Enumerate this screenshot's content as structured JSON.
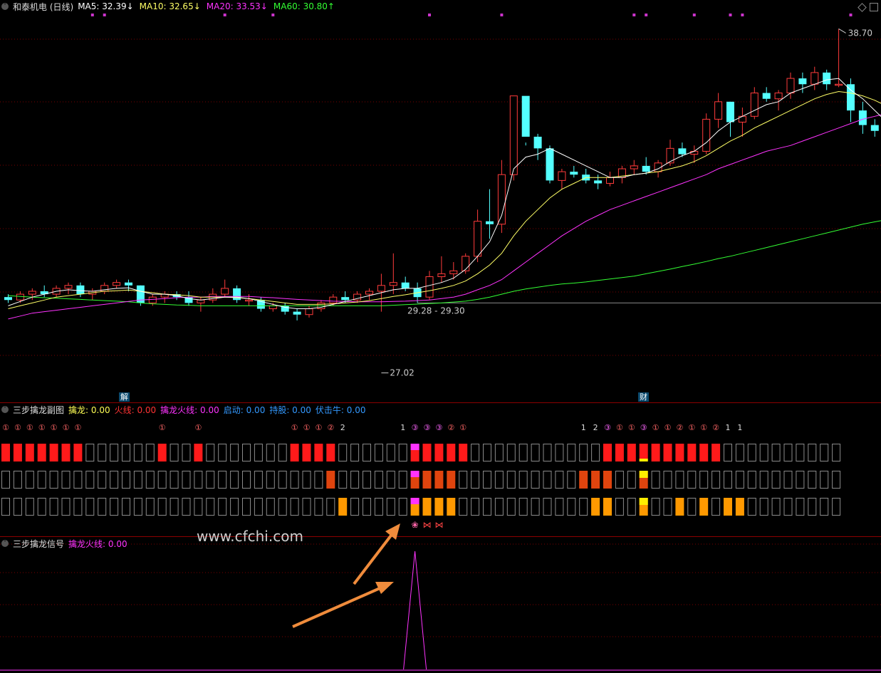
{
  "main": {
    "title": "和泰机电 (日线)",
    "ma": [
      {
        "label": "MA5: 32.39",
        "arrow": "↓",
        "color": "#ffffff"
      },
      {
        "label": "MA10: 32.65",
        "arrow": "↓",
        "color": "#ffff66"
      },
      {
        "label": "MA20: 33.53",
        "arrow": "↓",
        "color": "#ff33ff"
      },
      {
        "label": "MA60: 30.80",
        "arrow": "↑",
        "color": "#33ff33"
      }
    ],
    "high_label": "38.70",
    "low_label": "27.02",
    "range_label": "29.28 - 29.30",
    "tag_jie": "解",
    "tag_cai": "财",
    "colors": {
      "up": "#ff3b3b",
      "down": "#54ffff",
      "ma5": "#ffffff",
      "ma10": "#ffff66",
      "ma20": "#ff33ff",
      "ma60": "#33ff33",
      "grid": "#7a0000"
    },
    "price_range": [
      26.5,
      39.2
    ],
    "ohlc": [
      [
        29.5,
        29.6,
        29.3,
        29.4
      ],
      [
        29.4,
        29.7,
        29.3,
        29.6
      ],
      [
        29.6,
        29.8,
        29.4,
        29.7
      ],
      [
        29.7,
        29.9,
        29.5,
        29.6
      ],
      [
        29.6,
        29.9,
        29.5,
        29.8
      ],
      [
        29.8,
        30.0,
        29.6,
        29.9
      ],
      [
        29.9,
        30.0,
        29.5,
        29.6
      ],
      [
        29.6,
        29.8,
        29.4,
        29.7
      ],
      [
        29.7,
        30.0,
        29.6,
        29.9
      ],
      [
        29.9,
        30.1,
        29.8,
        30.0
      ],
      [
        30.0,
        30.1,
        29.7,
        29.9
      ],
      [
        29.9,
        29.9,
        29.2,
        29.3
      ],
      [
        29.3,
        29.6,
        29.2,
        29.5
      ],
      [
        29.5,
        29.7,
        29.3,
        29.6
      ],
      [
        29.6,
        29.7,
        29.4,
        29.5
      ],
      [
        29.5,
        29.7,
        29.2,
        29.3
      ],
      [
        29.3,
        29.5,
        29.0,
        29.4
      ],
      [
        29.4,
        29.8,
        29.3,
        29.6
      ],
      [
        29.6,
        30.1,
        29.5,
        29.8
      ],
      [
        29.8,
        29.9,
        29.3,
        29.4
      ],
      [
        29.4,
        29.6,
        29.2,
        29.4
      ],
      [
        29.4,
        29.5,
        29.0,
        29.1
      ],
      [
        29.1,
        29.3,
        29.0,
        29.2
      ],
      [
        29.2,
        29.3,
        28.9,
        29.0
      ],
      [
        29.0,
        29.1,
        28.7,
        28.9
      ],
      [
        28.9,
        29.2,
        28.8,
        29.1
      ],
      [
        29.1,
        29.4,
        29.0,
        29.3
      ],
      [
        29.3,
        29.6,
        29.2,
        29.5
      ],
      [
        29.5,
        29.7,
        29.3,
        29.4
      ],
      [
        29.4,
        29.7,
        29.3,
        29.6
      ],
      [
        29.6,
        29.8,
        29.4,
        29.7
      ],
      [
        29.7,
        30.3,
        29.0,
        29.9
      ],
      [
        29.9,
        31.0,
        29.6,
        30.0
      ],
      [
        30.0,
        30.2,
        29.7,
        29.8
      ],
      [
        29.8,
        30.0,
        29.3,
        29.5
      ],
      [
        29.5,
        30.4,
        29.4,
        30.2
      ],
      [
        30.2,
        30.9,
        30.0,
        30.3
      ],
      [
        30.3,
        30.7,
        30.1,
        30.4
      ],
      [
        30.4,
        31.0,
        30.3,
        30.9
      ],
      [
        30.9,
        32.5,
        30.7,
        32.1
      ],
      [
        32.1,
        33.2,
        31.5,
        32.0
      ],
      [
        32.0,
        34.2,
        31.7,
        33.7
      ],
      [
        33.7,
        36.4,
        33.5,
        36.4
      ],
      [
        36.4,
        34.8,
        34.7,
        35.0
      ],
      [
        35.0,
        35.1,
        34.2,
        34.6
      ],
      [
        34.6,
        34.7,
        33.4,
        33.5
      ],
      [
        33.5,
        33.9,
        33.2,
        33.8
      ],
      [
        33.8,
        34.0,
        33.6,
        33.7
      ],
      [
        33.7,
        33.9,
        33.4,
        33.5
      ],
      [
        33.5,
        33.7,
        33.2,
        33.4
      ],
      [
        33.4,
        33.8,
        33.3,
        33.6
      ],
      [
        33.6,
        34.0,
        33.4,
        33.9
      ],
      [
        33.9,
        34.2,
        33.7,
        34.0
      ],
      [
        34.0,
        34.3,
        33.7,
        33.8
      ],
      [
        33.8,
        34.2,
        33.6,
        34.1
      ],
      [
        34.1,
        34.9,
        34.0,
        34.6
      ],
      [
        34.6,
        34.8,
        34.3,
        34.4
      ],
      [
        34.4,
        34.7,
        34.1,
        34.5
      ],
      [
        34.5,
        35.8,
        34.4,
        35.6
      ],
      [
        35.6,
        36.5,
        35.3,
        36.2
      ],
      [
        36.2,
        36.2,
        35.0,
        35.5
      ],
      [
        35.5,
        36.0,
        35.0,
        35.7
      ],
      [
        35.7,
        36.7,
        35.6,
        36.5
      ],
      [
        36.5,
        36.7,
        36.2,
        36.3
      ],
      [
        36.3,
        36.6,
        35.9,
        36.5
      ],
      [
        36.5,
        37.2,
        36.3,
        37.0
      ],
      [
        37.0,
        37.2,
        36.5,
        36.8
      ],
      [
        36.8,
        37.4,
        36.6,
        37.2
      ],
      [
        37.2,
        37.3,
        36.6,
        36.8
      ],
      [
        36.8,
        38.7,
        36.7,
        36.8
      ],
      [
        36.8,
        37.0,
        35.5,
        35.9
      ],
      [
        35.9,
        36.2,
        35.1,
        35.4
      ],
      [
        35.4,
        35.6,
        35.0,
        35.2
      ],
      [
        35.2,
        35.5,
        34.9,
        35.3
      ],
      [
        35.3,
        35.5,
        34.6,
        34.8
      ],
      [
        34.8,
        35.2,
        34.4,
        34.5
      ],
      [
        34.5,
        34.7,
        34.2,
        34.3
      ],
      [
        34.3,
        34.8,
        34.2,
        34.6
      ],
      [
        34.6,
        35.0,
        34.5,
        34.9
      ],
      [
        34.9,
        35.2,
        34.5,
        35.0
      ],
      [
        35.0,
        35.3,
        34.3,
        34.4
      ]
    ],
    "ma5": [
      29.2,
      29.35,
      29.5,
      29.6,
      29.7,
      29.75,
      29.72,
      29.7,
      29.75,
      29.8,
      29.82,
      29.7,
      29.6,
      29.6,
      29.55,
      29.45,
      29.4,
      29.45,
      29.5,
      29.5,
      29.45,
      29.35,
      29.25,
      29.15,
      29.1,
      29.1,
      29.15,
      29.25,
      29.35,
      29.45,
      29.55,
      29.65,
      29.75,
      29.8,
      29.8,
      29.9,
      30.0,
      30.15,
      30.45,
      30.9,
      31.4,
      32.3,
      33.9,
      34.3,
      34.4,
      34.6,
      34.4,
      34.2,
      34.0,
      33.8,
      33.6,
      33.6,
      33.7,
      33.75,
      33.9,
      34.15,
      34.35,
      34.5,
      34.8,
      35.2,
      35.5,
      35.7,
      35.9,
      36.1,
      36.2,
      36.5,
      36.65,
      36.8,
      36.95,
      37.0,
      36.6,
      36.3,
      35.9,
      35.5,
      35.2,
      34.9,
      34.7,
      34.6,
      34.6,
      34.65,
      34.6
    ],
    "ma10": [
      29.1,
      29.2,
      29.3,
      29.4,
      29.5,
      29.55,
      29.6,
      29.65,
      29.7,
      29.72,
      29.74,
      29.7,
      29.65,
      29.6,
      29.58,
      29.55,
      29.5,
      29.5,
      29.5,
      29.48,
      29.45,
      29.4,
      29.35,
      29.3,
      29.25,
      29.25,
      29.25,
      29.27,
      29.3,
      29.33,
      29.38,
      29.45,
      29.52,
      29.58,
      29.65,
      29.72,
      29.8,
      29.9,
      30.05,
      30.3,
      30.6,
      31.0,
      31.6,
      32.1,
      32.5,
      32.9,
      33.2,
      33.4,
      33.6,
      33.6,
      33.6,
      33.65,
      33.7,
      33.75,
      33.8,
      33.9,
      34.0,
      34.15,
      34.35,
      34.6,
      34.85,
      35.05,
      35.3,
      35.5,
      35.7,
      35.9,
      36.1,
      36.3,
      36.45,
      36.55,
      36.5,
      36.4,
      36.25,
      36.05,
      35.85,
      35.65,
      35.45,
      35.25,
      35.1,
      34.95,
      34.8
    ],
    "ma20": [
      28.75,
      28.85,
      28.95,
      29.0,
      29.05,
      29.1,
      29.15,
      29.2,
      29.25,
      29.3,
      29.35,
      29.4,
      29.42,
      29.45,
      29.48,
      29.5,
      29.5,
      29.52,
      29.52,
      29.52,
      29.52,
      29.5,
      29.48,
      29.45,
      29.42,
      29.4,
      29.38,
      29.36,
      29.35,
      29.34,
      29.34,
      29.34,
      29.35,
      29.36,
      29.38,
      29.4,
      29.45,
      29.5,
      29.6,
      29.75,
      29.9,
      30.1,
      30.4,
      30.7,
      31.0,
      31.3,
      31.6,
      31.85,
      32.1,
      32.3,
      32.5,
      32.65,
      32.8,
      32.95,
      33.1,
      33.25,
      33.4,
      33.55,
      33.7,
      33.9,
      34.05,
      34.2,
      34.35,
      34.5,
      34.6,
      34.7,
      34.85,
      35.0,
      35.15,
      35.3,
      35.45,
      35.6,
      35.7,
      35.8,
      35.9,
      35.95,
      36.0,
      36.05,
      36.1,
      36.05,
      36.0
    ],
    "ma60": [
      29.55,
      29.52,
      29.5,
      29.48,
      29.46,
      29.44,
      29.42,
      29.4,
      29.38,
      29.36,
      29.34,
      29.3,
      29.27,
      29.25,
      29.23,
      29.22,
      29.2,
      29.2,
      29.2,
      29.2,
      29.2,
      29.2,
      29.2,
      29.2,
      29.2,
      29.2,
      29.2,
      29.2,
      29.2,
      29.2,
      29.2,
      29.2,
      29.22,
      29.24,
      29.26,
      29.28,
      29.3,
      29.33,
      29.36,
      29.42,
      29.5,
      29.6,
      29.7,
      29.78,
      29.84,
      29.9,
      29.95,
      29.98,
      30.02,
      30.07,
      30.12,
      30.17,
      30.22,
      30.3,
      30.38,
      30.46,
      30.55,
      30.63,
      30.72,
      30.82,
      30.9,
      31.0,
      31.1,
      31.2,
      31.3,
      31.4,
      31.5,
      31.6,
      31.7,
      31.8,
      31.9,
      32.0,
      32.08,
      32.16,
      32.24,
      32.32,
      32.4,
      32.48,
      32.56,
      32.64,
      32.72
    ],
    "top_markers": [
      7,
      8,
      18,
      22,
      35,
      41,
      52,
      53,
      57,
      60,
      61,
      70
    ]
  },
  "sub1": {
    "title": "三步擒龙副图",
    "items": [
      {
        "label": "擒龙: 0.00",
        "color": "#ffff55"
      },
      {
        "label": "火线: 0.00",
        "color": "#ff3333"
      },
      {
        "label": "擒龙火线: 0.00",
        "color": "#ff33ff"
      },
      {
        "label": "启动: 0.00",
        "color": "#3399ff"
      },
      {
        "label": "持股: 0.00",
        "color": "#3399ff"
      },
      {
        "label": "伏击牛: 0.00",
        "color": "#3399ff"
      }
    ],
    "row1_on": [
      0,
      1,
      2,
      3,
      4,
      5,
      6,
      13,
      16,
      24,
      25,
      26,
      27,
      34,
      35,
      36,
      37,
      38,
      50,
      51,
      52,
      53,
      54,
      55,
      56,
      57,
      58,
      59
    ],
    "row1_pink": [
      34
    ],
    "row1_yellow": [
      53
    ],
    "row2_on": [
      27,
      34,
      35,
      36,
      37,
      48,
      49,
      50,
      53
    ],
    "row2_pink": [
      34
    ],
    "row2_yellow": [
      53
    ],
    "row3_on": [
      28,
      34,
      35,
      36,
      37,
      49,
      50,
      53,
      56,
      58,
      60,
      61
    ],
    "row3_pink": [
      34
    ],
    "row3_yellow": [
      53
    ],
    "marks": [
      {
        "i": 0,
        "t": "①"
      },
      {
        "i": 1,
        "t": "①"
      },
      {
        "i": 2,
        "t": "①"
      },
      {
        "i": 3,
        "t": "①"
      },
      {
        "i": 4,
        "t": "①"
      },
      {
        "i": 5,
        "t": "①"
      },
      {
        "i": 6,
        "t": "①"
      },
      {
        "i": 13,
        "t": "①"
      },
      {
        "i": 16,
        "t": "①"
      },
      {
        "i": 24,
        "t": "①"
      },
      {
        "i": 25,
        "t": "①"
      },
      {
        "i": 26,
        "t": "①"
      },
      {
        "i": 27,
        "t": "②"
      },
      {
        "i": 28,
        "t": "2"
      },
      {
        "i": 33,
        "t": "1"
      },
      {
        "i": 34,
        "t": "③"
      },
      {
        "i": 35,
        "t": "③"
      },
      {
        "i": 36,
        "t": "③"
      },
      {
        "i": 37,
        "t": "②"
      },
      {
        "i": 38,
        "t": "①"
      },
      {
        "i": 48,
        "t": "1"
      },
      {
        "i": 49,
        "t": "2"
      },
      {
        "i": 50,
        "t": "③"
      },
      {
        "i": 51,
        "t": "①"
      },
      {
        "i": 52,
        "t": "①"
      },
      {
        "i": 53,
        "t": "③"
      },
      {
        "i": 54,
        "t": "①"
      },
      {
        "i": 55,
        "t": "①"
      },
      {
        "i": 56,
        "t": "②"
      },
      {
        "i": 57,
        "t": "①"
      },
      {
        "i": 58,
        "t": "①"
      },
      {
        "i": 59,
        "t": "②"
      },
      {
        "i": 60,
        "t": "1"
      },
      {
        "i": 61,
        "t": "1"
      }
    ]
  },
  "sub2": {
    "title": "三步擒龙信号",
    "item": {
      "label": "擒龙火线: 0.00",
      "color": "#ff33ff"
    }
  },
  "watermark": "www.cfchi.com"
}
